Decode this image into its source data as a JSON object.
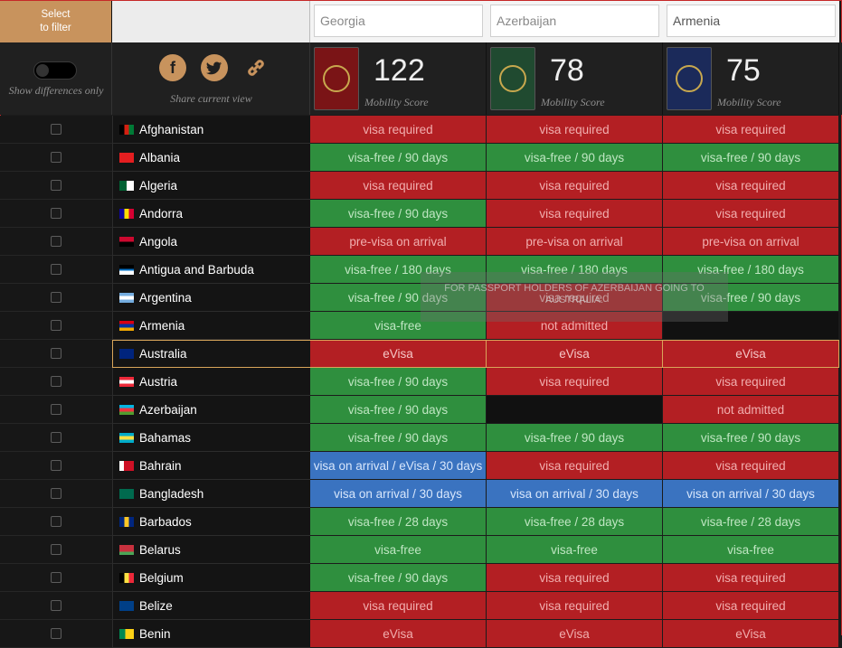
{
  "filter": {
    "select_label_1": "Select",
    "select_label_2": "to filter"
  },
  "searches": [
    {
      "value": "Georgia"
    },
    {
      "value": "Azerbaijan"
    },
    {
      "value": "Armenia"
    }
  ],
  "toggle": {
    "label": "Show differences only"
  },
  "share": {
    "label": "Share current view",
    "icons": [
      "facebook-icon",
      "twitter-icon",
      "link-icon"
    ]
  },
  "passports": [
    {
      "country": "Georgia",
      "score": "122",
      "score_label": "Mobility Score",
      "color": "#7a1416"
    },
    {
      "country": "Azerbaijan",
      "score": "78",
      "score_label": "Mobility Score",
      "color": "#204a30"
    },
    {
      "country": "Armenia",
      "score": "75",
      "score_label": "Mobility Score",
      "color": "#1b2a5a"
    }
  ],
  "rows": [
    {
      "country": "Afghanistan",
      "cells": [
        "visa required",
        "visa required",
        "visa required"
      ],
      "types": [
        "red",
        "red",
        "red"
      ]
    },
    {
      "country": "Albania",
      "cells": [
        "visa-free / 90 days",
        "visa-free / 90 days",
        "visa-free / 90 days"
      ],
      "types": [
        "green",
        "green",
        "green"
      ]
    },
    {
      "country": "Algeria",
      "cells": [
        "visa required",
        "visa required",
        "visa required"
      ],
      "types": [
        "red",
        "red",
        "red"
      ]
    },
    {
      "country": "Andorra",
      "cells": [
        "visa-free / 90 days",
        "visa required",
        "visa required"
      ],
      "types": [
        "green",
        "red",
        "red"
      ]
    },
    {
      "country": "Angola",
      "cells": [
        "pre-visa on arrival",
        "pre-visa on arrival",
        "pre-visa on arrival"
      ],
      "types": [
        "red",
        "red",
        "red"
      ]
    },
    {
      "country": "Antigua and Barbuda",
      "cells": [
        "visa-free / 180 days",
        "visa-free / 180 days",
        "visa-free / 180 days"
      ],
      "types": [
        "green",
        "green",
        "green"
      ]
    },
    {
      "country": "Argentina",
      "cells": [
        "visa-free / 90 days",
        "visa required",
        "visa-free / 90 days"
      ],
      "types": [
        "green",
        "red",
        "green"
      ]
    },
    {
      "country": "Armenia",
      "cells": [
        "visa-free",
        "not admitted",
        ""
      ],
      "types": [
        "green",
        "red",
        "black"
      ]
    },
    {
      "country": "Australia",
      "cells": [
        "eVisa",
        "eVisa",
        "eVisa"
      ],
      "types": [
        "evisa",
        "evisa",
        "evisa"
      ],
      "highlight": true
    },
    {
      "country": "Austria",
      "cells": [
        "visa-free / 90 days",
        "visa required",
        "visa required"
      ],
      "types": [
        "green",
        "red",
        "red"
      ]
    },
    {
      "country": "Azerbaijan",
      "cells": [
        "visa-free / 90 days",
        "",
        "not admitted"
      ],
      "types": [
        "green",
        "black",
        "red"
      ]
    },
    {
      "country": "Bahamas",
      "cells": [
        "visa-free / 90 days",
        "visa-free / 90 days",
        "visa-free / 90 days"
      ],
      "types": [
        "green",
        "green",
        "green"
      ]
    },
    {
      "country": "Bahrain",
      "cells": [
        "visa on arrival / eVisa / 30 days",
        "visa required",
        "visa required"
      ],
      "types": [
        "blue",
        "red",
        "red"
      ]
    },
    {
      "country": "Bangladesh",
      "cells": [
        "visa on arrival / 30 days",
        "visa on arrival / 30 days",
        "visa on arrival / 30 days"
      ],
      "types": [
        "blue",
        "blue",
        "blue"
      ]
    },
    {
      "country": "Barbados",
      "cells": [
        "visa-free / 28 days",
        "visa-free / 28 days",
        "visa-free / 28 days"
      ],
      "types": [
        "green",
        "green",
        "green"
      ]
    },
    {
      "country": "Belarus",
      "cells": [
        "visa-free",
        "visa-free",
        "visa-free"
      ],
      "types": [
        "green",
        "green",
        "green"
      ]
    },
    {
      "country": "Belgium",
      "cells": [
        "visa-free / 90 days",
        "visa required",
        "visa required"
      ],
      "types": [
        "green",
        "red",
        "red"
      ]
    },
    {
      "country": "Belize",
      "cells": [
        "visa required",
        "visa required",
        "visa required"
      ],
      "types": [
        "red",
        "red",
        "red"
      ]
    },
    {
      "country": "Benin",
      "cells": [
        "eVisa",
        "eVisa",
        "eVisa"
      ],
      "types": [
        "red",
        "red",
        "red"
      ]
    }
  ],
  "tooltip": {
    "text": "FOR PASSPORT HOLDERS OF AZERBAIJAN GOING TO AUSTRALIA."
  },
  "colors": {
    "accent": "#c8935d",
    "red": "#b31f23",
    "green": "#2f8f3e",
    "blue": "#3a73c0"
  }
}
